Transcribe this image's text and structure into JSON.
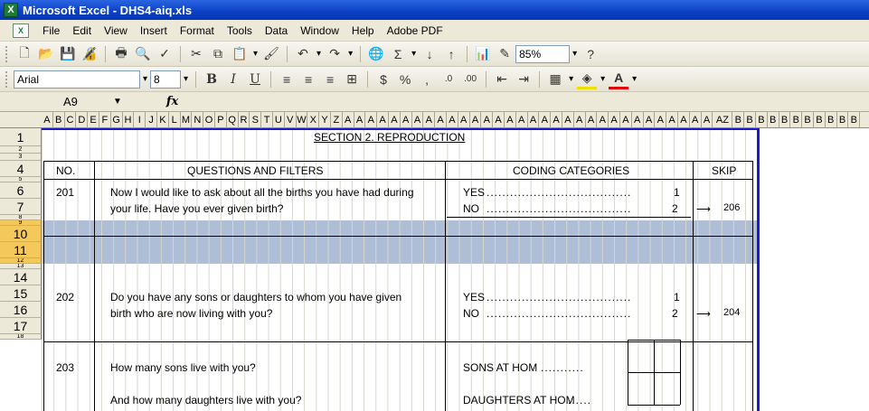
{
  "window": {
    "title": "Microsoft Excel - DHS4-aiq.xls",
    "app_icon": "excel-icon"
  },
  "menu": {
    "items": [
      "File",
      "Edit",
      "View",
      "Insert",
      "Format",
      "Tools",
      "Data",
      "Window",
      "Help",
      "Adobe PDF"
    ]
  },
  "standard_toolbar": {
    "zoom": "85%"
  },
  "formatting_toolbar": {
    "font": "Arial",
    "size": "8"
  },
  "formula_bar": {
    "name_box": "A9",
    "fx_label": "fx"
  },
  "columns": [
    "A",
    "B",
    "C",
    "D",
    "E",
    "F",
    "G",
    "H",
    "I",
    "J",
    "K",
    "L",
    "M",
    "N",
    "O",
    "P",
    "Q",
    "R",
    "S",
    "T",
    "U",
    "V",
    "W",
    "X",
    "Y",
    "Z",
    "A",
    "A",
    "A",
    "A",
    "A",
    "A",
    "A",
    "A",
    "A",
    "A",
    "A",
    "A",
    "A",
    "A",
    "A",
    "A",
    "A",
    "A",
    "A",
    "A",
    "A",
    "A",
    "A",
    "A",
    "A",
    "A",
    "A",
    "A",
    "A",
    "A",
    "A",
    "A",
    "AZ",
    "B",
    "B",
    "B",
    "B",
    "B",
    "B",
    "B",
    "B",
    "B",
    "B",
    "B"
  ],
  "rows": [
    {
      "label": "1",
      "h": 20
    },
    {
      "label": "2",
      "h": 8
    },
    {
      "label": "3",
      "h": 8
    },
    {
      "label": "4",
      "h": 18
    },
    {
      "label": "5",
      "h": 6
    },
    {
      "label": "6",
      "h": 18
    },
    {
      "label": "7",
      "h": 18
    },
    {
      "label": "8",
      "h": 6
    },
    {
      "label": "9",
      "h": 6
    },
    {
      "label": "10",
      "h": 18
    },
    {
      "label": "11",
      "h": 18
    },
    {
      "label": "12",
      "h": 6
    },
    {
      "label": "13",
      "h": 6
    },
    {
      "label": "14",
      "h": 18
    },
    {
      "label": "15",
      "h": 18
    },
    {
      "label": "16",
      "h": 18
    },
    {
      "label": "17",
      "h": 18
    },
    {
      "label": "18",
      "h": 6
    }
  ],
  "sheet": {
    "section_title": "SECTION 2. REPRODUCTION",
    "headers": {
      "no": "NO.",
      "questions": "QUESTIONS AND FILTERS",
      "coding": "CODING CATEGORIES",
      "skip": "SKIP"
    },
    "q201": {
      "no": "201",
      "line1": "Now I would like to ask about all the births you have had during",
      "line2": "your life. Have you ever given birth?",
      "yes": "YES",
      "yes_code": "1",
      "no_label": "NO",
      "no_code": "2",
      "skip": "206"
    },
    "q202": {
      "no": "202",
      "line1": "Do you have any sons or daughters to whom you have given",
      "line2": "birth who are now living with you?",
      "yes": "YES",
      "yes_code": "1",
      "no_label": "NO",
      "no_code": "2",
      "skip": "204"
    },
    "q203": {
      "no": "203",
      "line1": "How many sons live with you?",
      "line2": "And how many daughters live with you?",
      "sons": "SONS AT HOM",
      "daughters": "DAUGHTERS AT HOM"
    }
  },
  "colors": {
    "title_bar": "#0a3fc4",
    "selection": "#aebed6",
    "frame": "#1a1acc"
  }
}
